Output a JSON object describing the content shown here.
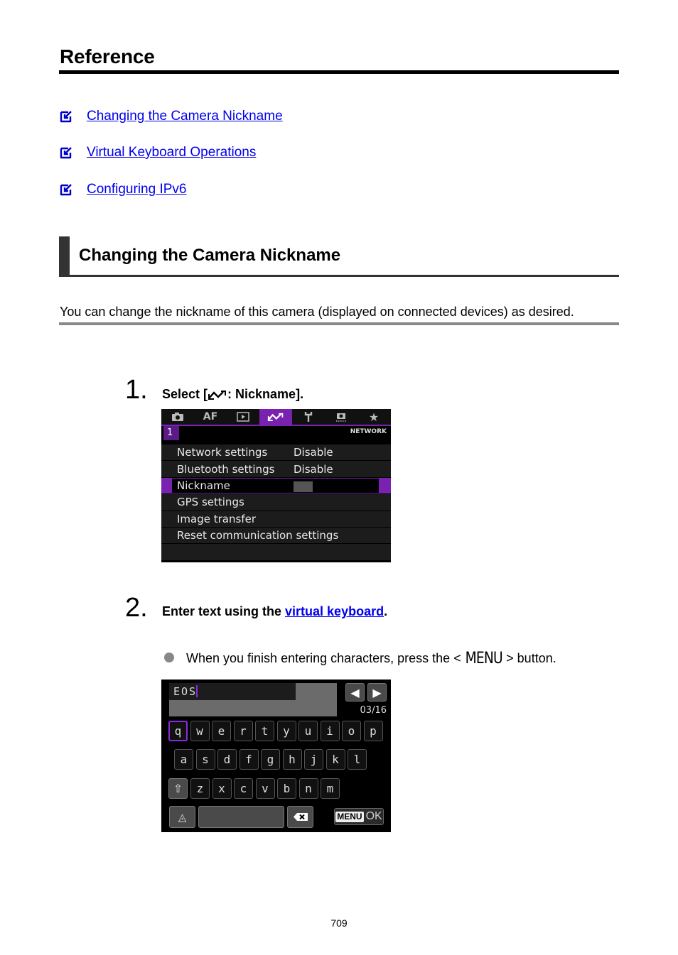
{
  "page": {
    "title": "Reference",
    "page_number": "709"
  },
  "toc": {
    "items": [
      {
        "label": "Changing the Camera Nickname",
        "icon": "checkbox-arrow-icon"
      },
      {
        "label": "Virtual Keyboard Operations",
        "icon": "checkbox-arrow-icon"
      },
      {
        "label": "Configuring IPv6",
        "icon": "checkbox-arrow-icon"
      }
    ]
  },
  "section": {
    "title": "Changing the Camera Nickname",
    "intro": "You can change the nickname of this camera (displayed on connected devices) as desired."
  },
  "steps": [
    {
      "number": "1.",
      "text_before": "Select [",
      "icon": "network-icon",
      "text_after": ": Nickname]."
    },
    {
      "number": "2.",
      "text_before": "Enter text using the ",
      "link": "virtual keyboard",
      "text_after": ".",
      "bullet": {
        "before": "When you finish entering characters, press the <",
        "glyph": "MENU",
        "after": "> button."
      }
    }
  ],
  "camera_menu": {
    "tabs": [
      {
        "name": "shooting-tab",
        "label": "",
        "icon": "camera-icon"
      },
      {
        "name": "af-tab",
        "label": "AF",
        "icon": ""
      },
      {
        "name": "playback-tab",
        "label": "",
        "icon": "playback-icon"
      },
      {
        "name": "network-tab",
        "label": "",
        "icon": "network-icon",
        "active": true
      },
      {
        "name": "setup-tab",
        "label": "",
        "icon": "wrench-icon"
      },
      {
        "name": "custom-tab",
        "label": "",
        "icon": "custom-function-icon"
      },
      {
        "name": "mymenu-tab",
        "label": "",
        "icon": "star-icon"
      }
    ],
    "page_badge": "1",
    "category": "NETWORK",
    "rows": [
      {
        "label": "Network settings",
        "value": "Disable"
      },
      {
        "label": "Bluetooth settings",
        "value": "Disable"
      },
      {
        "label": "Nickname",
        "value": "",
        "selected": true
      },
      {
        "label": "GPS settings",
        "value": ""
      },
      {
        "label": "Image transfer",
        "value": ""
      },
      {
        "label": "Reset communication settings",
        "value": ""
      }
    ],
    "colors": {
      "accent": "#7a22b0"
    }
  },
  "virtual_keyboard": {
    "input_value": "EOS",
    "char_count": "03/16",
    "rows": [
      [
        "q",
        "w",
        "e",
        "r",
        "t",
        "y",
        "u",
        "i",
        "o",
        "p"
      ],
      [
        "a",
        "s",
        "d",
        "f",
        "g",
        "h",
        "j",
        "k",
        "l"
      ],
      [
        "z",
        "x",
        "c",
        "v",
        "b",
        "n",
        "m"
      ]
    ],
    "focused_key": "q",
    "arrow_left": "🡐",
    "arrow_right": "🡒",
    "shift_glyph": "⇧",
    "mode_glyph": "◬",
    "backspace_glyph": "✖",
    "menu_label": "MENU",
    "ok_label": "OK",
    "colors": {
      "focus": "#8a2be2"
    }
  }
}
